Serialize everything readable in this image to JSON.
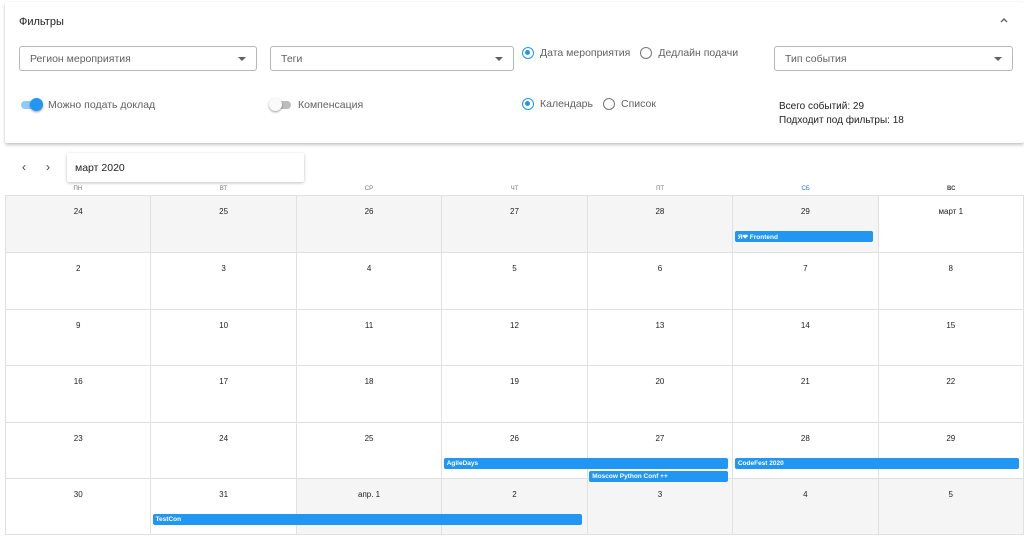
{
  "filters": {
    "title": "Фильтры",
    "region_placeholder": "Регион мероприятия",
    "tags_placeholder": "Теги",
    "date_radio": [
      "Дата мероприятия",
      "Дедлайн подачи"
    ],
    "type_placeholder": "Тип события",
    "switch_talk": "Можно подать доклад",
    "switch_comp": "Компенсация",
    "view_radio": [
      "Календарь",
      "Список"
    ],
    "total_events": "Всего событий: 29",
    "matching_events": "Подходит под фильтры: 18"
  },
  "nav": {
    "prev": "‹",
    "next": "›",
    "month": "март 2020"
  },
  "calendar": {
    "weekdays": [
      "ПН",
      "ВТ",
      "СР",
      "ЧТ",
      "ПТ",
      "СБ",
      "ВС"
    ],
    "days": [
      "24",
      "25",
      "26",
      "27",
      "28",
      "29",
      "март 1",
      "2",
      "3",
      "4",
      "5",
      "6",
      "7",
      "8",
      "9",
      "10",
      "11",
      "12",
      "13",
      "14",
      "15",
      "16",
      "17",
      "18",
      "19",
      "20",
      "21",
      "22",
      "23",
      "24",
      "25",
      "26",
      "27",
      "28",
      "29",
      "30",
      "31",
      "апр. 1",
      "2",
      "3",
      "4",
      "5"
    ],
    "events": [
      {
        "label": "Я❤ Frontend",
        "row": 0,
        "col": 5,
        "span": 1
      },
      {
        "label": "AgileDays",
        "row": 4,
        "col": 3,
        "span": 2
      },
      {
        "label": "Moscow Python Conf ++",
        "row": 4,
        "col": 4,
        "span": 1,
        "slot": 1
      },
      {
        "label": "CodeFest 2020",
        "row": 4,
        "col": 5,
        "span": 2
      },
      {
        "label": "TestCon",
        "row": 5,
        "col": 1,
        "span": 3
      }
    ]
  },
  "colors": {
    "accent": "#2196f3"
  }
}
